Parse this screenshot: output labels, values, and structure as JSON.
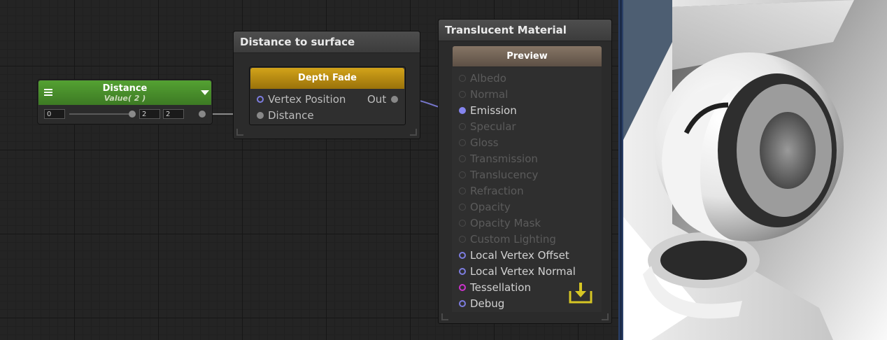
{
  "value_node": {
    "title": "Distance",
    "subtitle": "Value( 2 )",
    "min": "0",
    "value": "2",
    "max": "2"
  },
  "function_group": {
    "title": "Distance to surface",
    "node": {
      "title": "Depth Fade",
      "inputs": [
        "Vertex Position",
        "Distance"
      ],
      "output": "Out"
    }
  },
  "material_node": {
    "title": "Translucent Material",
    "preview_label": "Preview",
    "inputs": [
      {
        "label": "Albedo",
        "state": "off"
      },
      {
        "label": "Normal",
        "state": "off"
      },
      {
        "label": "Emission",
        "state": "connected"
      },
      {
        "label": "Specular",
        "state": "off"
      },
      {
        "label": "Gloss",
        "state": "off"
      },
      {
        "label": "Transmission",
        "state": "off"
      },
      {
        "label": "Translucency",
        "state": "off"
      },
      {
        "label": "Refraction",
        "state": "off"
      },
      {
        "label": "Opacity",
        "state": "off"
      },
      {
        "label": "Opacity Mask",
        "state": "off"
      },
      {
        "label": "Custom Lighting",
        "state": "off"
      },
      {
        "label": "Local Vertex Offset",
        "state": "on"
      },
      {
        "label": "Local Vertex Normal",
        "state": "on"
      },
      {
        "label": "Tessellation",
        "state": "tess"
      },
      {
        "label": "Debug",
        "state": "on"
      }
    ]
  },
  "colors": {
    "value_header": "#4a8f2c",
    "depth_fade_header": "#c0960f",
    "preview_header": "#7a6a5a",
    "wire": "#7777cc",
    "tessellation_port": "#cc33cc",
    "save_icon": "#d6c624"
  },
  "icons": [
    "menu-icon",
    "dropdown-triangle-icon",
    "save-download-icon"
  ]
}
